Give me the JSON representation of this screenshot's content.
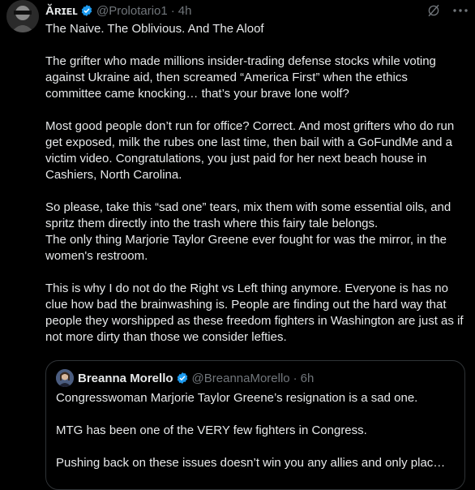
{
  "tweet": {
    "display_name": "Ăʀɪᴇʟ",
    "handle": "@Prolotario1",
    "time": "4h",
    "separator": "·",
    "paragraphs": [
      "The Naive. The Oblivious. And The Aloof",
      "The grifter who made millions insider-trading defense stocks while voting against Ukraine aid, then screamed “America First” when the ethics committee came knocking… that’s your brave lone wolf?",
      "Most good people don’t run for office? Correct. And most grifters who do run get exposed, milk the rubes one last time, then bail with a GoFundMe and a victim video. Congratulations, you just paid for her next beach house in Cashiers, North Carolina.",
      "So please, take this “sad one” tears, mix them with some essential oils, and spritz them directly into the trash where this fairy tale belongs.\nThe only thing Marjorie Taylor Greene ever fought for was the mirror, in the women's restroom.",
      "This is why I do not do the Right vs Left thing anymore. Everyone is has no clue how bad the brainwashing is. People are finding out the hard way that people they worshipped as these freedom fighters in Washington are just as if not more dirty than those we consider lefties."
    ]
  },
  "quote": {
    "display_name": "Breanna Morello",
    "handle": "@BreannaMorello",
    "time": "6h",
    "separator": "·",
    "paragraphs": [
      "Congresswoman Marjorie Taylor Greene’s resignation is a sad one.",
      "MTG has been one of the VERY few fighters in Congress.",
      "Pushing back on these issues doesn’t win you any allies and only plac…"
    ]
  },
  "icons": {
    "verified": "verified-badge-icon",
    "grok": "grok-icon",
    "more": "more-options-icon"
  },
  "colors": {
    "background": "#000000",
    "text": "#e7e9ea",
    "secondary": "#71767b",
    "border": "#2f3336",
    "verified": "#1d9bf0"
  }
}
